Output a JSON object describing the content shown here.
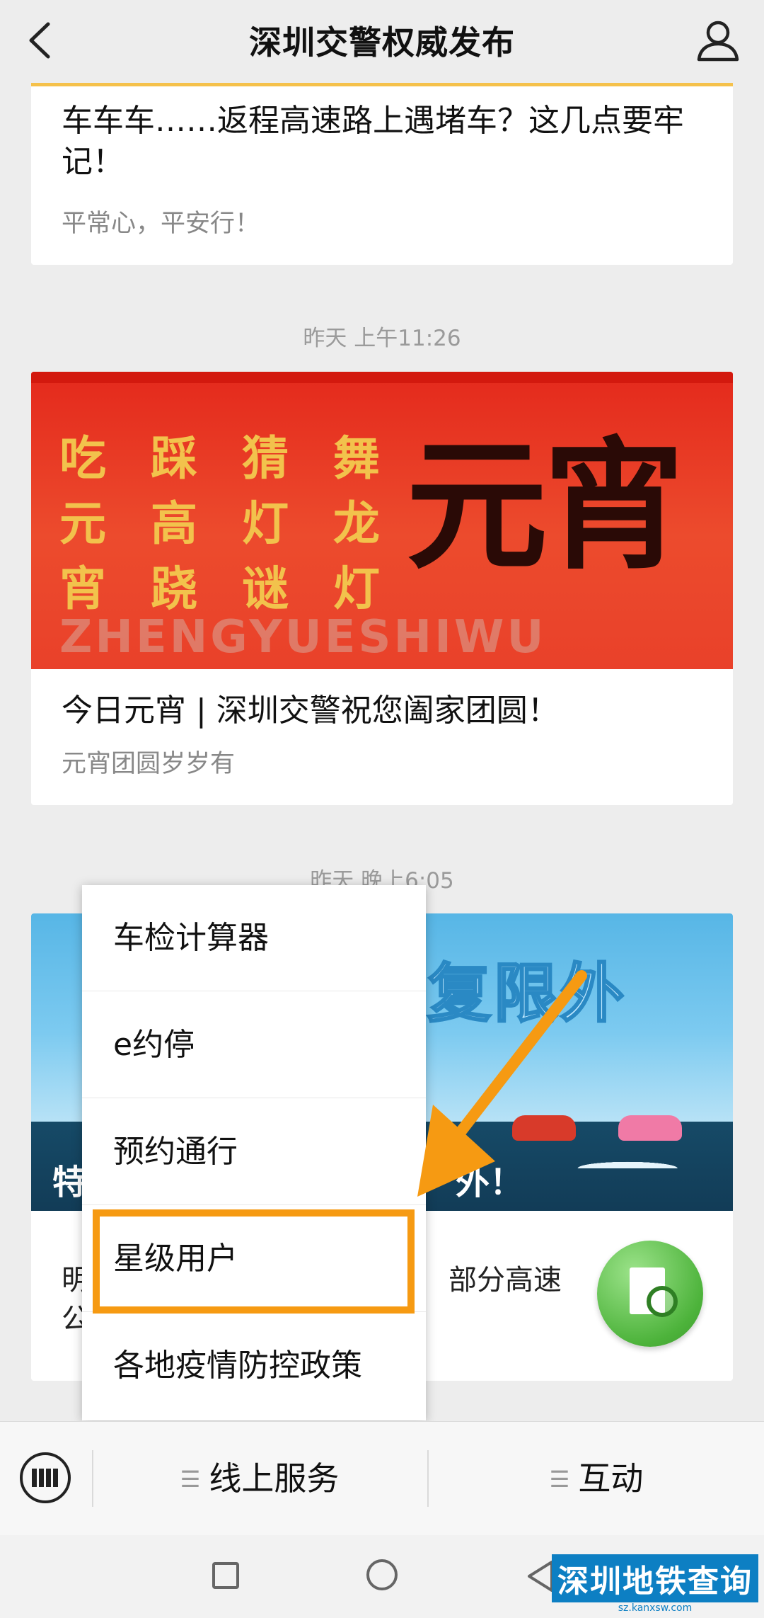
{
  "header": {
    "title": "深圳交警权威发布"
  },
  "feed": {
    "card1": {
      "title": "车车车……返程高速路上遇堵车？这几点要牢记！",
      "subtitle": "平常心，平安行！"
    },
    "timestamp2": "昨天 上午11:26",
    "card2": {
      "banner_couplet": [
        "吃 踩 猜 舞",
        "元 高 灯 龙",
        "宵 跷 谜 灯"
      ],
      "banner_big": "元宵",
      "banner_en": "ZHENGYUESHIWU",
      "title": "今日元宵 | 深圳交警祝您阖家团圆！",
      "subtitle": "元宵团圆岁岁有"
    },
    "timestamp3": "昨天 晚上6:05",
    "card3": {
      "banner_headline": "复限外",
      "banner_caption_left": "特",
      "banner_caption_right": "外！",
      "text_left_line1": "明",
      "text_left_line2": "公",
      "text_right": "部分高速"
    }
  },
  "menu": {
    "items": [
      "车检计算器",
      "e约停",
      "预约通行",
      "星级用户",
      "各地疫情防控政策"
    ],
    "highlighted": "星级用户",
    "highlight_color": "#f69a12"
  },
  "bottom_bar": {
    "items": [
      "线上服务",
      "互动"
    ]
  },
  "watermark": {
    "main": "深圳地铁查询",
    "sub": "sz.kanxsw.com"
  },
  "icons": {
    "back": "back-chevron-icon",
    "profile": "user-profile-icon",
    "keyboard": "keyboard-icon",
    "menu": "hamburger-icon",
    "document": "document-search-icon"
  }
}
